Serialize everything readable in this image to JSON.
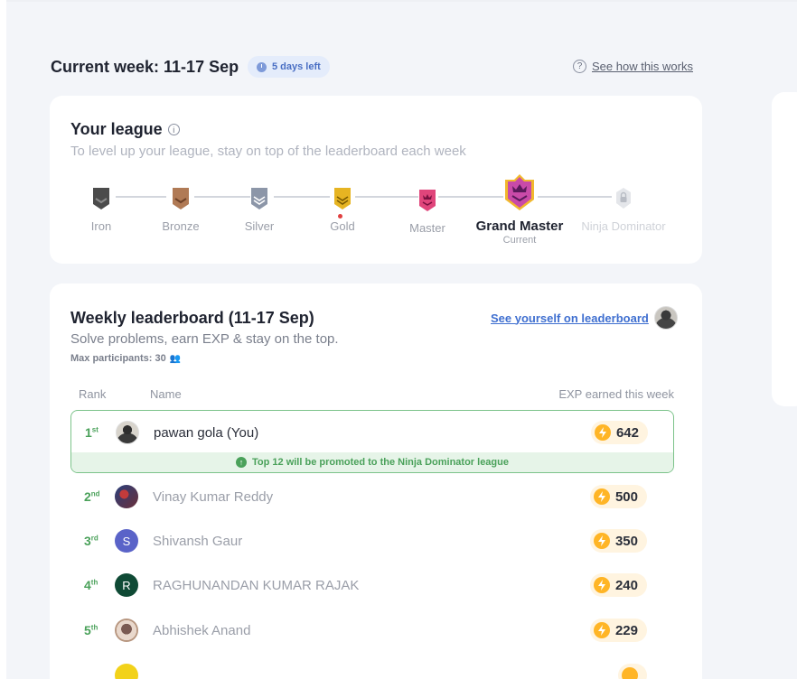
{
  "header": {
    "title": "Current week: 11-17 Sep",
    "days_left": "5 days left",
    "how_link": "See how this works"
  },
  "league": {
    "title": "Your league",
    "subtitle": "To level up your league, stay on top of the leaderboard each week",
    "tiers": [
      {
        "name": "Iron",
        "color": "#5a5a5a"
      },
      {
        "name": "Bronze",
        "color": "#b07a55"
      },
      {
        "name": "Silver",
        "color": "#8c96a8"
      },
      {
        "name": "Gold",
        "color": "#e6b422"
      },
      {
        "name": "Master",
        "color": "#e0457b"
      },
      {
        "name": "Grand Master",
        "color": "#c94aa8",
        "status": "Current"
      },
      {
        "name": "Ninja Dominator",
        "color": "#d7d9de"
      }
    ]
  },
  "leaderboard": {
    "title": "Weekly leaderboard (11-17 Sep)",
    "subtitle": "Solve problems, earn EXP & stay on the top.",
    "max_participants": "Max participants: 30",
    "see_self": "See yourself on leaderboard",
    "columns": {
      "rank": "Rank",
      "name": "Name",
      "exp": "EXP earned this week"
    },
    "promotion_note": "Top 12 will be promoted to the Ninja Dominator league",
    "rows": [
      {
        "rank": "1",
        "suffix": "st",
        "name": "pawan gola (You)",
        "exp": "642",
        "avatar": "photo"
      },
      {
        "rank": "2",
        "suffix": "nd",
        "name": "Vinay Kumar Reddy",
        "exp": "500",
        "avatar": "photo"
      },
      {
        "rank": "3",
        "suffix": "rd",
        "name": "Shivansh Gaur",
        "exp": "350",
        "avatar_letter": "S",
        "avatar_color": "#5a63c8"
      },
      {
        "rank": "4",
        "suffix": "th",
        "name": "RAGHUNANDAN KUMAR RAJAK",
        "exp": "240",
        "avatar_letter": "R",
        "avatar_color": "#0f4a35"
      },
      {
        "rank": "5",
        "suffix": "th",
        "name": "Abhishek Anand",
        "exp": "229",
        "avatar": "photo"
      }
    ]
  }
}
